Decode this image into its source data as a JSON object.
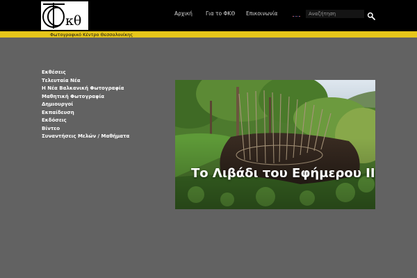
{
  "header": {
    "logo_letters": "κθ",
    "nav": [
      {
        "label": "Αρχική"
      },
      {
        "label": "Για το ΦΚΘ"
      },
      {
        "label": "Επικοινωνία"
      }
    ],
    "language_flag": "uk-flag-icon",
    "search": {
      "placeholder": "Αναζήτηση"
    },
    "search_icon": "search-icon"
  },
  "tagline": "Φωτογραφικό Κέντρο Θεσσαλονίκης",
  "sidebar": {
    "items": [
      {
        "label": "Εκθέσεις"
      },
      {
        "label": "Τελευταία Νέα"
      },
      {
        "label": "Η Νέα Βαλκανική Φωτογραφία"
      },
      {
        "label": "Μαθητική Φωτογραφία"
      },
      {
        "label": "Δημιουργοί"
      },
      {
        "label": "Εκπαίδευση"
      },
      {
        "label": "Εκδόσεις"
      },
      {
        "label": "Βίντεο"
      },
      {
        "label": "Συναντήσεις Μελών / Μαθήματα"
      }
    ]
  },
  "feature": {
    "title": "Το Λιβάδι του Εφήμερου ΙΙ"
  },
  "colors": {
    "background": "#626262",
    "header": "#000000",
    "accent_strip": "#e6c61a"
  }
}
